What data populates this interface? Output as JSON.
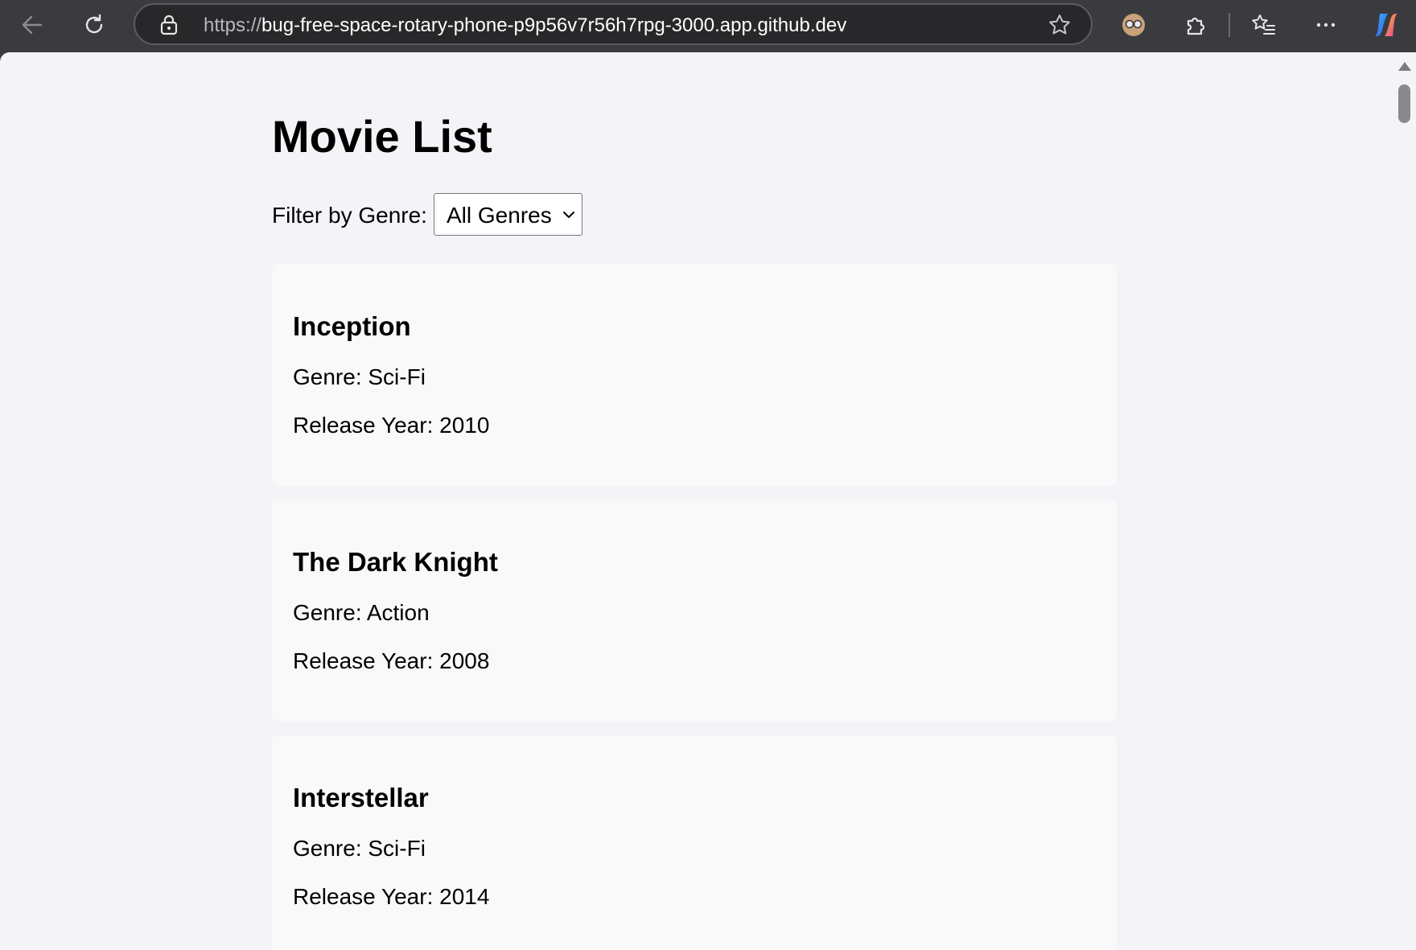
{
  "browser": {
    "url_scheme": "https://",
    "url_host": "bug-free-space-rotary-phone-p9p56v7r56h7rpg-3000.app.github.dev",
    "icons": {
      "back": "arrow-left-icon",
      "reload": "reload-icon",
      "lock": "lock-icon",
      "favorite": "star-icon",
      "profile": "profile-avatar-icon",
      "extensions": "puzzle-icon",
      "favorites": "favorites-list-icon",
      "more": "more-dots-icon",
      "copilot": "copilot-icon"
    }
  },
  "page": {
    "title": "Movie List",
    "filter": {
      "label": "Filter by Genre:",
      "selected": "All Genres"
    },
    "genre_prefix": "Genre: ",
    "year_prefix": "Release Year: ",
    "movies": [
      {
        "title": "Inception",
        "genre_line": "Genre: Sci-Fi",
        "year_line": "Release Year: 2010"
      },
      {
        "title": "The Dark Knight",
        "genre_line": "Genre: Action",
        "year_line": "Release Year: 2008"
      },
      {
        "title": "Interstellar",
        "genre_line": "Genre: Sci-Fi",
        "year_line": "Release Year: 2014"
      }
    ]
  },
  "colors": {
    "chrome_bg": "#3b3b3f",
    "page_bg": "#f4f4f8",
    "card_bg": "#f9f9fa"
  }
}
